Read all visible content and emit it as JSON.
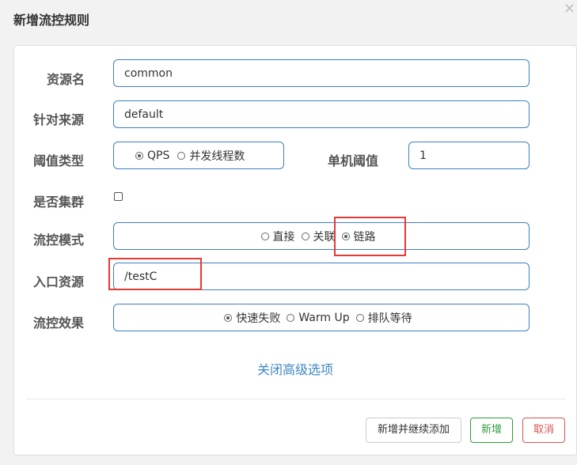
{
  "dialog": {
    "title": "新增流控规则",
    "close_glyph": "×"
  },
  "form": {
    "resource_name": {
      "label": "资源名",
      "value": "common"
    },
    "limit_app": {
      "label": "针对来源",
      "value": "default"
    },
    "threshold_type": {
      "label": "阈值类型",
      "options": [
        "QPS",
        "并发线程数"
      ],
      "selected": "QPS"
    },
    "single_threshold": {
      "label": "单机阈值",
      "value": "1"
    },
    "cluster": {
      "label": "是否集群",
      "checked": false
    },
    "flow_mode": {
      "label": "流控模式",
      "options": [
        "直接",
        "关联",
        "链路"
      ],
      "selected": "链路"
    },
    "entry_resource": {
      "label": "入口资源",
      "value": "/testC"
    },
    "flow_effect": {
      "label": "流控效果",
      "options": [
        "快速失败",
        "Warm Up",
        "排队等待"
      ],
      "selected": "快速失败"
    },
    "toggle_advanced": "关闭高级选项"
  },
  "buttons": {
    "add_and_continue": "新增并继续添加",
    "add": "新增",
    "cancel": "取消"
  },
  "colors": {
    "accent": "#3d7fc2",
    "link": "#3d86c6",
    "add_button": "#2e9e3a",
    "cancel_button": "#d9534f",
    "highlight": "#e53935"
  }
}
